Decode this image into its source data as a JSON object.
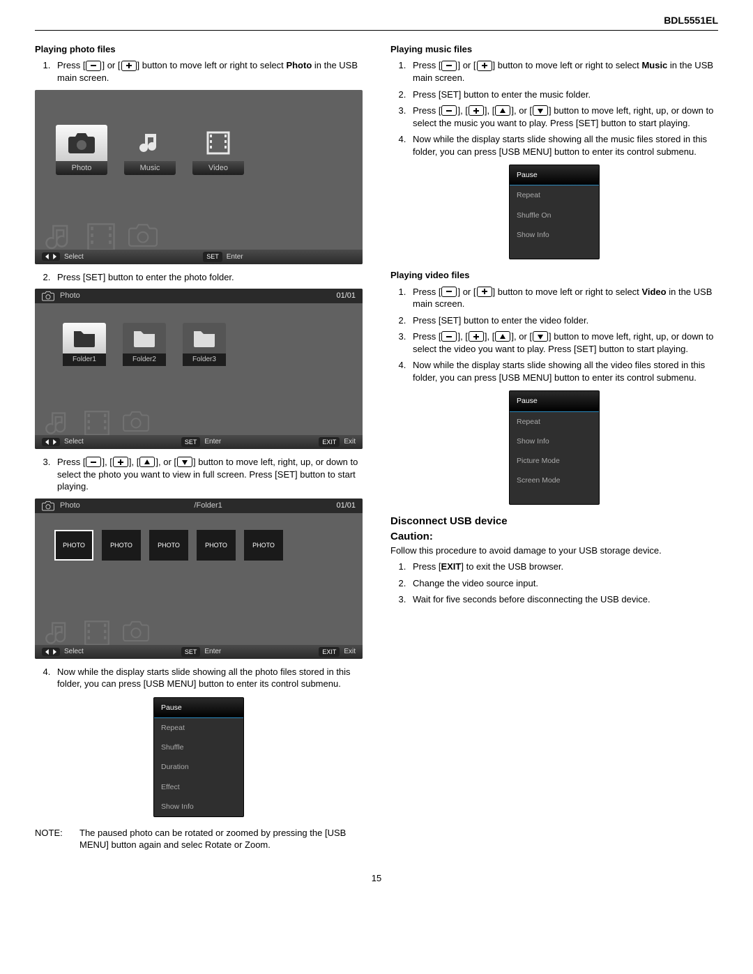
{
  "model": "BDL5551EL",
  "pageNumber": "15",
  "left": {
    "h_photo": "Playing photo files",
    "step1": "button to move left or right to select",
    "step1_sel": "Photo",
    "step1_tail": " in the USB main screen.",
    "press": "Press ",
    "or": " or ",
    "step2": "Press [SET] button to enter the photo folder.",
    "step3a": "Press ",
    "step3b": " button to move left, right, up, or down to select the photo you want to view in full screen. Press [SET] button to start playing.",
    "step4": "Now while the display starts slide showing all the photo files stored in this folder, you can press [USB MENU] button to enter its control submenu.",
    "noteLabel": "NOTE:",
    "noteText": "The paused photo can be rotated or zoomed by pressing the [USB MENU] button again and selec Rotate or Zoom.",
    "shot1": {
      "photo": "Photo",
      "music": "Music",
      "video": "Video",
      "select": "Select",
      "enter": "Enter",
      "set": "SET"
    },
    "shot2": {
      "title": "Photo",
      "count": "01/01",
      "f1": "Folder1",
      "f2": "Folder2",
      "f3": "Folder3",
      "select": "Select",
      "enter": "Enter",
      "exit": "Exit",
      "set": "SET",
      "exitBtn": "EXIT"
    },
    "shot3": {
      "title": "Photo",
      "path": "/Folder1",
      "count": "01/01",
      "photo": "PHOTO",
      "select": "Select",
      "enter": "Enter",
      "exit": "Exit",
      "set": "SET",
      "exitBtn": "EXIT"
    },
    "menu1": {
      "i0": "Pause",
      "i1": "Repeat",
      "i2": "Shuffle",
      "i3": "Duration",
      "i4": "Effect",
      "i5": "Show Info"
    }
  },
  "right": {
    "h_music": "Playing music files",
    "m1_sel": "Music",
    "m1_tail": " in the USB main screen.",
    "m2": "Press [SET] button to enter the music folder.",
    "m3": " button to move left, right, up, or down to select the music you want to play. Press [SET] button to start playing.",
    "m4": "Now while the display starts slide showing all the music files stored in this folder, you can press [USB MENU] button to enter its control submenu.",
    "menu_music": {
      "i0": "Pause",
      "i1": "Repeat",
      "i2": "Shuffle On",
      "i3": "Show Info"
    },
    "h_video": "Playing video files",
    "v1_sel": "Video",
    "v1_tail": " in the USB main screen.",
    "v2": "Press [SET] button to enter the video folder.",
    "v3": " button to move left, right, up, or down to select the video you want to play. Press [SET] button to start playing.",
    "v4": "Now while the display starts slide showing all the video files stored in this folder, you can press [USB MENU] button to enter its control submenu.",
    "menu_video": {
      "i0": "Pause",
      "i1": "Repeat",
      "i2": "Show Info",
      "i3": "Picture Mode",
      "i4": "Screen Mode"
    },
    "h_usb": "Disconnect USB device",
    "h_caution": "Caution:",
    "caution_p": "Follow this procedure to avoid damage to your USB storage device.",
    "u1a": "Press [",
    "u1b": "EXIT",
    "u1c": "] to exit the USB browser.",
    "u2": "Change the video source input.",
    "u3": "Wait for five seconds before disconnecting the USB device.",
    "step1_common": "button to move left or right to select"
  }
}
